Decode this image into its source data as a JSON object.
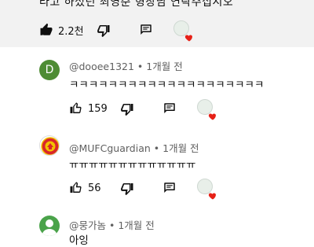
{
  "top_comment": {
    "text": "라고 하셨던 최영준 형장님 연락주십시오",
    "like_count": "2.2천"
  },
  "comments": [
    {
      "avatar_letter": "D",
      "author": "@dooee1321",
      "time": "1개월 전",
      "text": "ㅋㅋㅋㅋㅋㅋㅋㅋㅋㅋㅋㅋㅋㅋㅋㅋㅋㅋㅋㅋ",
      "like_count": "159"
    },
    {
      "author": "@MUFCguardian",
      "time": "1개월 전",
      "text": "ㅠㅠㅠㅠㅠㅠㅠㅠㅠㅠㅠㅠㅠ",
      "like_count": "56"
    },
    {
      "author": "@뭉가놈",
      "time": "1개월 전",
      "text": "아잉"
    }
  ],
  "separator": "•",
  "icons": {
    "like": "thumbs-up-icon",
    "dislike": "thumbs-down-icon",
    "reply": "reply-comment-icon",
    "creator_heart": "creator-heart-icon"
  },
  "colors": {
    "heart": "#e62117",
    "avatar_d": "#4e8c34",
    "meta_text": "#606060"
  }
}
